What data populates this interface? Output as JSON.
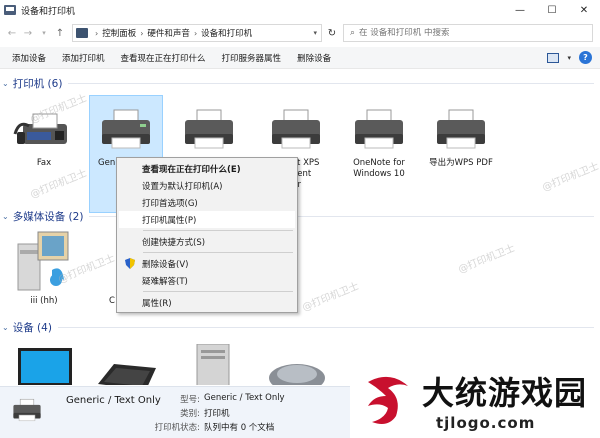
{
  "window": {
    "title": "设备和打印机",
    "controls": {
      "minimize": "—",
      "maximize": "☐",
      "close": "✕"
    }
  },
  "address": {
    "back": "←",
    "forward": "→",
    "up": "↑",
    "crumbs": [
      "控制面板",
      "硬件和声音",
      "设备和打印机"
    ],
    "refresh": "↻",
    "search_placeholder": "在 设备和打印机 中搜索"
  },
  "toolbar": {
    "buttons": [
      "添加设备",
      "添加打印机",
      "查看现在正在打印什么",
      "打印服务器属性",
      "删除设备"
    ],
    "help": "?"
  },
  "groups": {
    "printers": {
      "label": "打印机 (6)",
      "items": [
        {
          "caption": "Fax"
        },
        {
          "caption": "Generic / Text Only"
        },
        {
          "caption": ""
        },
        {
          "caption": "Microsoft XPS Document Writer"
        },
        {
          "caption": "OneNote for Windows 10"
        },
        {
          "caption": "导出为WPS PDF"
        }
      ]
    },
    "multimedia": {
      "label": "多媒体设备 (2)",
      "items": [
        {
          "caption": "iii (hh)"
        },
        {
          "caption": "C"
        }
      ]
    },
    "devices": {
      "label": "设备 (4)"
    }
  },
  "context_menu": {
    "items": [
      {
        "label": "查看现在正在打印什么(E)",
        "bold": true
      },
      {
        "label": "设置为默认打印机(A)"
      },
      {
        "label": "打印首选项(G)"
      },
      {
        "label": "打印机属性(P)",
        "hover": true
      },
      {
        "sep": true
      },
      {
        "label": "创建快捷方式(S)"
      },
      {
        "sep": true
      },
      {
        "label": "删除设备(V)",
        "icon": "uac-shield-icon"
      },
      {
        "label": "疑难解答(T)"
      },
      {
        "sep": true
      },
      {
        "label": "属性(R)"
      }
    ]
  },
  "details": {
    "name": "Generic / Text Only",
    "props": [
      {
        "key": "型号:",
        "value": "Generic / Text Only"
      },
      {
        "key": "类别:",
        "value": "打印机"
      },
      {
        "key": "打印机状态:",
        "value": "队列中有 0 个文档"
      }
    ]
  },
  "watermarks": [
    "@打印机卫士",
    "@打印机卫士",
    "@打印机卫士",
    "@打印机卫士",
    "@打印机卫士",
    "@打印机卫士"
  ],
  "brand": {
    "title": "大统游戏园",
    "url": "tjlogo.com",
    "accent": "#c8102e"
  },
  "colors": {
    "group_header": "#1e3b8a",
    "selection": "#cce8ff",
    "details_bg": "#f0f4fa"
  }
}
